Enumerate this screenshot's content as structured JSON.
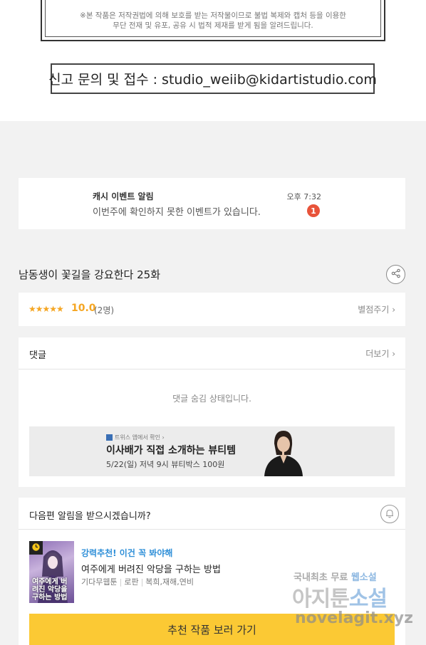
{
  "notice": {
    "line1": "※본 작품은 저작권법에 의해 보호를 받는 저작물이므로 불법 복제와 캡처 등을 이용한",
    "line2": "무단 전재 및 유포, 공유 시 법적 제재를 받게 됨을 알려드립니다."
  },
  "report": {
    "text": "신고 문의 및 접수 : studio_weiib@kidartistudio.com"
  },
  "cash_event": {
    "title": "캐시 이벤트 알림",
    "time": "오후 7:32",
    "description": "이번주에 확인하지 못한 이벤트가 있습니다.",
    "badge_count": "1"
  },
  "episode": {
    "title": "남동생이 꽃길을 강요한다 25화",
    "share_icon": "share-icon"
  },
  "rating": {
    "stars": "★★★★★",
    "score": "10.0",
    "count": "(2명)",
    "rate_link": "별점주기",
    "chevron": "›"
  },
  "comments": {
    "title": "댓글",
    "more_link": "더보기",
    "chevron": "›",
    "hidden_message": "댓글 숨김 상태입니다."
  },
  "ad": {
    "small_label": "트위스 앱에서 확인 ›",
    "title": "이사배가 직접 소개하는 뷰티템",
    "subtitle": "5/22(일) 저녁 9시 뷰티박스 100원"
  },
  "next_episode": {
    "question": "다음편 알림을 받으시겠습니까?",
    "bell_icon": "bell-icon"
  },
  "recommendation": {
    "label": "강력추천! 이건 꼭 봐야해",
    "title": "여주에게 버려진 악당을 구하는 방법",
    "tags": [
      "기다무웹툰",
      "로판",
      "복희,재해,연비"
    ],
    "thumb_text": "여주에게 버려진 악당을 구하는 방법",
    "button_label": "추천 작품 보러 가기"
  },
  "watermark": {
    "top_prefix": "국내최초 무료 ",
    "top_accent": "웹소설",
    "mid_prefix": "아지툰",
    "mid_accent": "소설",
    "bottom": "novelagit.xyz"
  },
  "colors": {
    "accent_yellow": "#fbc934",
    "star_orange": "#f5a623",
    "badge_red": "#e8533a",
    "link_blue": "#2f8fd8"
  }
}
